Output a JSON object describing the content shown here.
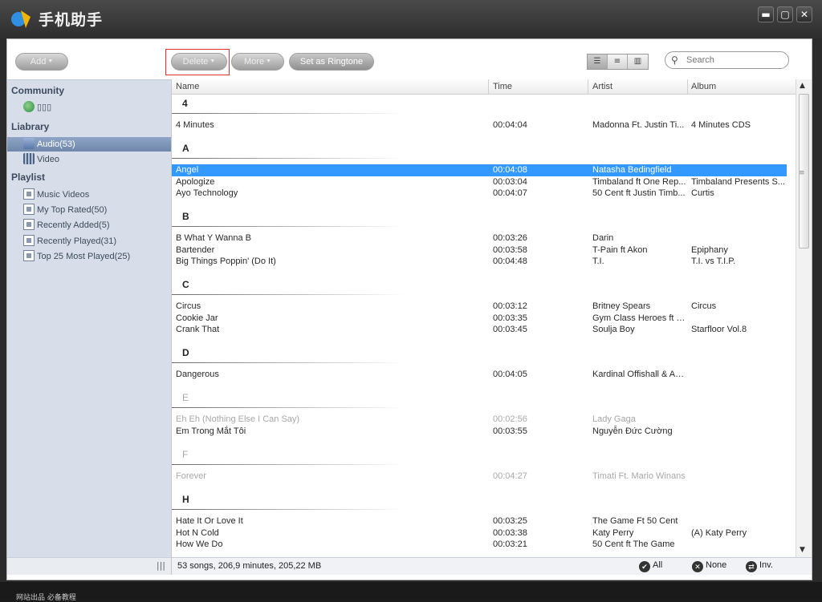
{
  "app": {
    "title": "手机助手"
  },
  "window_controls": {
    "minimize": "▬",
    "maximize": "▢",
    "close": "✕"
  },
  "toolbar": {
    "add_label": "Add",
    "delete_label": "Delete",
    "more_label": "More",
    "ringtone_label": "Set as Ringtone",
    "search_placeholder": "Search",
    "view_buttons": [
      "list-view",
      "detail-view",
      "column-view"
    ]
  },
  "sidebar": {
    "community_header": "Community",
    "community_item": "▯▯▯",
    "library_header": "Liabrary",
    "audio": "Audio(53)",
    "video": "Video",
    "playlist_header": "Playlist",
    "playlists": [
      "Music Videos",
      "My Top Rated(50)",
      "Recently Added(5)",
      "Recently Played(31)",
      "Top 25 Most Played(25)"
    ],
    "grip": "|||"
  },
  "columns": {
    "name": "Name",
    "time": "Time",
    "artist": "Artist",
    "album": "Album"
  },
  "groups": [
    {
      "label": "4",
      "faded": false,
      "rows": [
        {
          "name": "4 Minutes",
          "time": "00:04:04",
          "artist": "Madonna Ft. Justin Ti...",
          "album": "4 Minutes CDS"
        }
      ]
    },
    {
      "label": "A",
      "faded": false,
      "rows": [
        {
          "name": "Angel",
          "time": "00:04:08",
          "artist": "Natasha Bedingfield",
          "album": "",
          "selected": true
        },
        {
          "name": "Apologize",
          "time": "00:03:04",
          "artist": "Timbaland ft One Rep...",
          "album": "Timbaland Presents S..."
        },
        {
          "name": "Ayo Technology",
          "time": "00:04:07",
          "artist": "50 Cent ft Justin Timb...",
          "album": "Curtis"
        }
      ]
    },
    {
      "label": "B",
      "faded": false,
      "rows": [
        {
          "name": "B What Y Wanna B",
          "time": "00:03:26",
          "artist": "Darin",
          "album": ""
        },
        {
          "name": "Bartender",
          "time": "00:03:58",
          "artist": "T-Pain ft Akon",
          "album": "Epiphany"
        },
        {
          "name": "Big Things Poppin' (Do It)",
          "time": "00:04:48",
          "artist": "T.I.",
          "album": "T.I. vs T.I.P."
        }
      ]
    },
    {
      "label": "C",
      "faded": false,
      "rows": [
        {
          "name": "Circus",
          "time": "00:03:12",
          "artist": "Britney Spears",
          "album": "Circus"
        },
        {
          "name": "Cookie Jar",
          "time": "00:03:35",
          "artist": "Gym Class Heroes ft T...",
          "album": ""
        },
        {
          "name": "Crank That",
          "time": "00:03:45",
          "artist": "Soulja Boy",
          "album": "Starfloor Vol.8"
        }
      ]
    },
    {
      "label": "D",
      "faded": false,
      "rows": [
        {
          "name": "Dangerous",
          "time": "00:04:05",
          "artist": "Kardinal Offishall & Akon",
          "album": ""
        }
      ]
    },
    {
      "label": "E",
      "faded": true,
      "rows": [
        {
          "name": "Eh Eh (Nothing Else I Can Say)",
          "time": "00:02:56",
          "artist": "Lady Gaga",
          "album": "",
          "faded": true
        },
        {
          "name": "Em Trong Mắt Tôi",
          "time": "00:03:55",
          "artist": "Nguyễn Đức Cường",
          "album": ""
        }
      ]
    },
    {
      "label": "F",
      "faded": true,
      "rows": [
        {
          "name": "Forever",
          "time": "00:04:27",
          "artist": "Timati Ft. Mario Winans",
          "album": "",
          "faded": true
        }
      ]
    },
    {
      "label": "H",
      "faded": false,
      "rows": [
        {
          "name": "Hate It Or Love It",
          "time": "00:03:25",
          "artist": "The Game Ft 50 Cent",
          "album": ""
        },
        {
          "name": "Hot N Cold",
          "time": "00:03:38",
          "artist": "Katy Perry",
          "album": "(A) Katy Perry"
        },
        {
          "name": "How We Do",
          "time": "00:03:21",
          "artist": "50 Cent ft The Game",
          "album": ""
        }
      ]
    }
  ],
  "status": {
    "summary": "53 songs, 206,9 minutes, 205,22 MB",
    "all_label": "All",
    "none_label": "None",
    "inv_label": "Inv."
  },
  "bottom": {
    "text": "网站出品 必备教程"
  }
}
